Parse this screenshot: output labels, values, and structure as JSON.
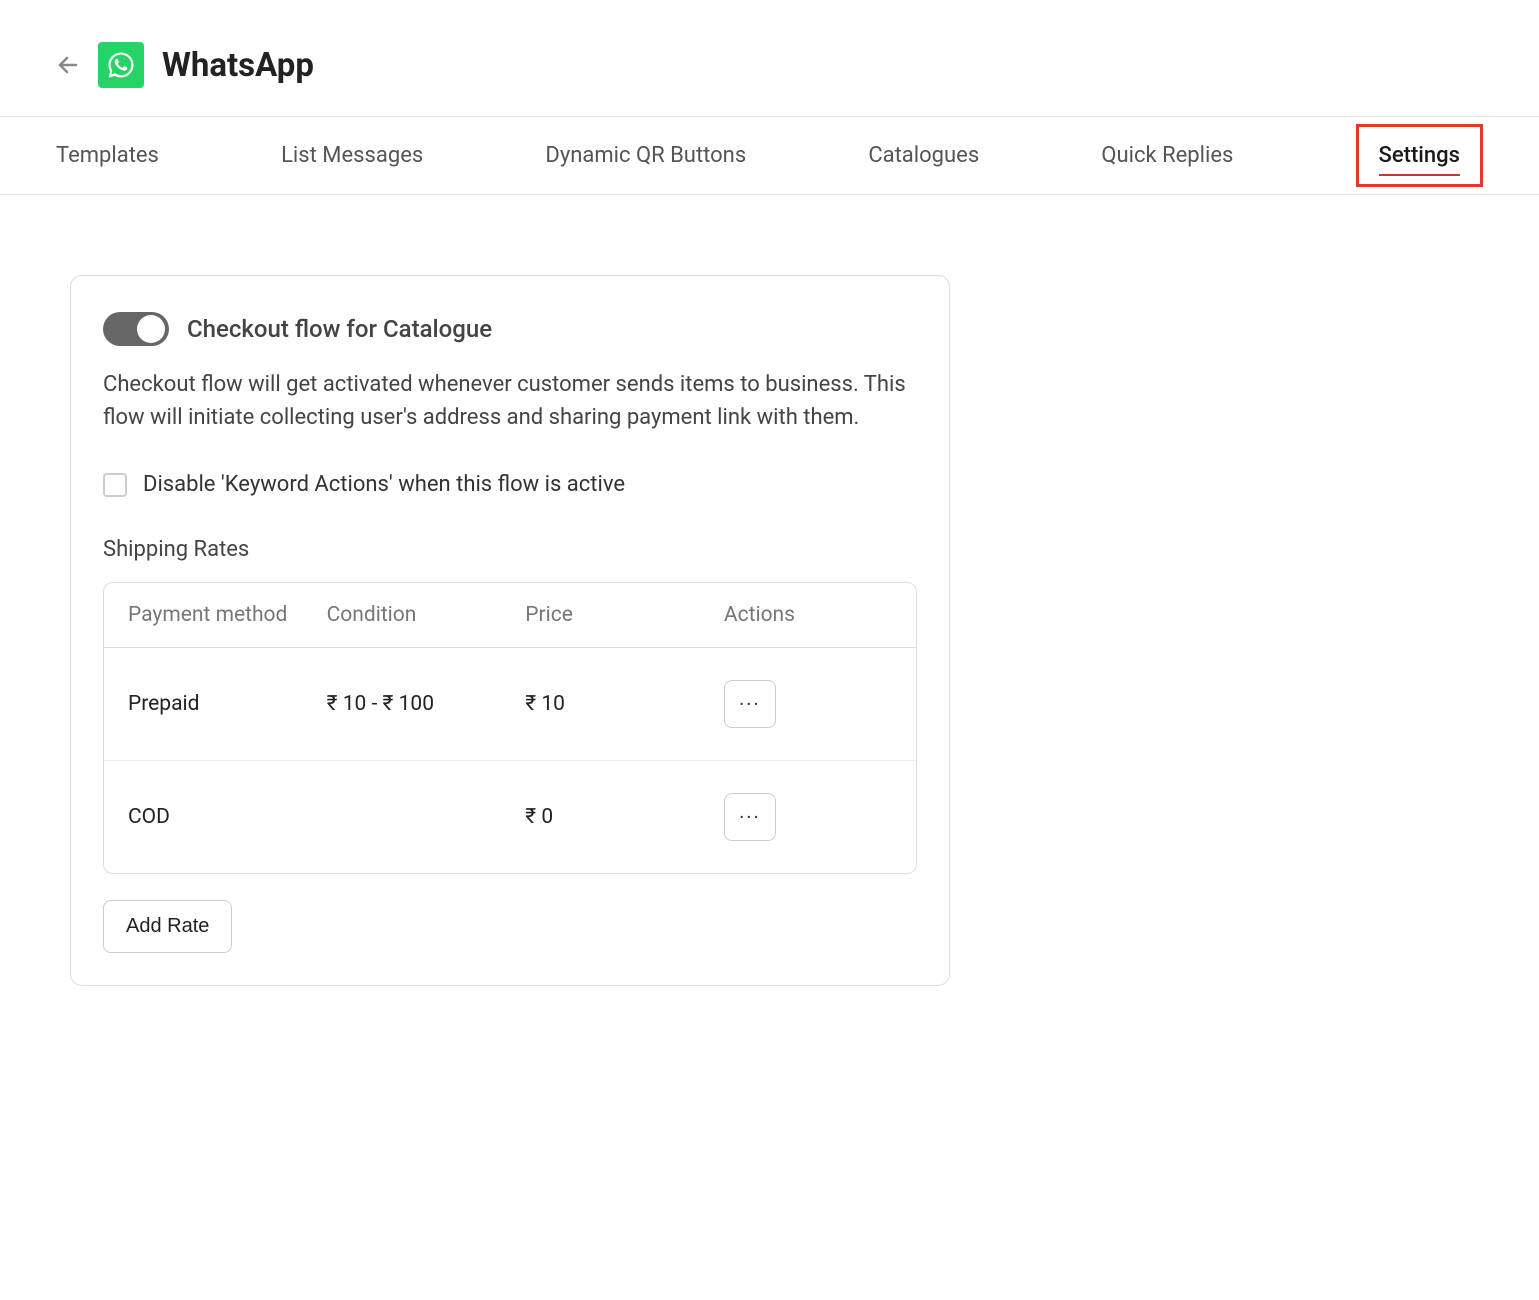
{
  "header": {
    "title": "WhatsApp"
  },
  "tabs": [
    {
      "label": "Templates",
      "active": false
    },
    {
      "label": "List Messages",
      "active": false
    },
    {
      "label": "Dynamic QR Buttons",
      "active": false
    },
    {
      "label": "Catalogues",
      "active": false
    },
    {
      "label": "Quick Replies",
      "active": false
    },
    {
      "label": "Settings",
      "active": true
    }
  ],
  "settings": {
    "toggle_label": "Checkout flow for Catalogue",
    "toggle_enabled": true,
    "description": "Checkout flow will get activated whenever customer sends items to business. This flow will initiate collecting user's address and sharing payment link with them.",
    "disable_keyword_label": "Disable 'Keyword Actions' when this flow is active",
    "disable_keyword_checked": false,
    "shipping_title": "Shipping Rates",
    "table": {
      "headers": {
        "payment": "Payment method",
        "condition": "Condition",
        "price": "Price",
        "actions": "Actions"
      },
      "rows": [
        {
          "payment": "Prepaid",
          "condition": "₹ 10 - ₹ 100",
          "price": "₹ 10"
        },
        {
          "payment": "COD",
          "condition": "",
          "price": "₹ 0"
        }
      ]
    },
    "add_rate_label": "Add Rate"
  }
}
